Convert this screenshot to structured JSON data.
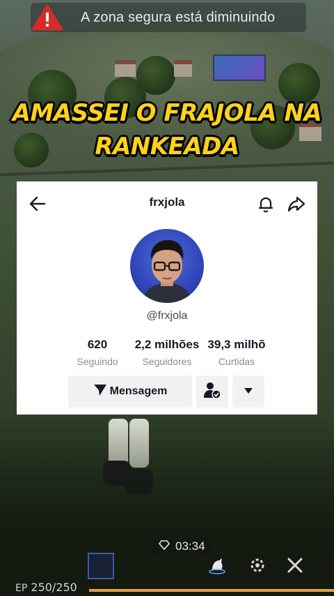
{
  "warning": {
    "text": "A zona segura está diminuindo",
    "icon": "warning-triangle-icon"
  },
  "title": {
    "line1": "AMASSEI O FRAJOLA NA",
    "line2": "RANKEADA"
  },
  "profile": {
    "username": "frxjola",
    "handle": "@frxjola",
    "stats": [
      {
        "value": "620",
        "label": "Seguindo"
      },
      {
        "value": "2,2 milhões",
        "label": "Seguidores"
      },
      {
        "value": "39,3 milhõ",
        "label": "Curtidas"
      }
    ],
    "message_button": "Mensagem"
  },
  "hud": {
    "timer": "03:34",
    "ep_label": "EP",
    "ep_value": "250/250"
  },
  "colors": {
    "title_yellow": "#ffd21a",
    "warning_red": "#d62b2b",
    "ep_bar": "#e2a23a"
  }
}
